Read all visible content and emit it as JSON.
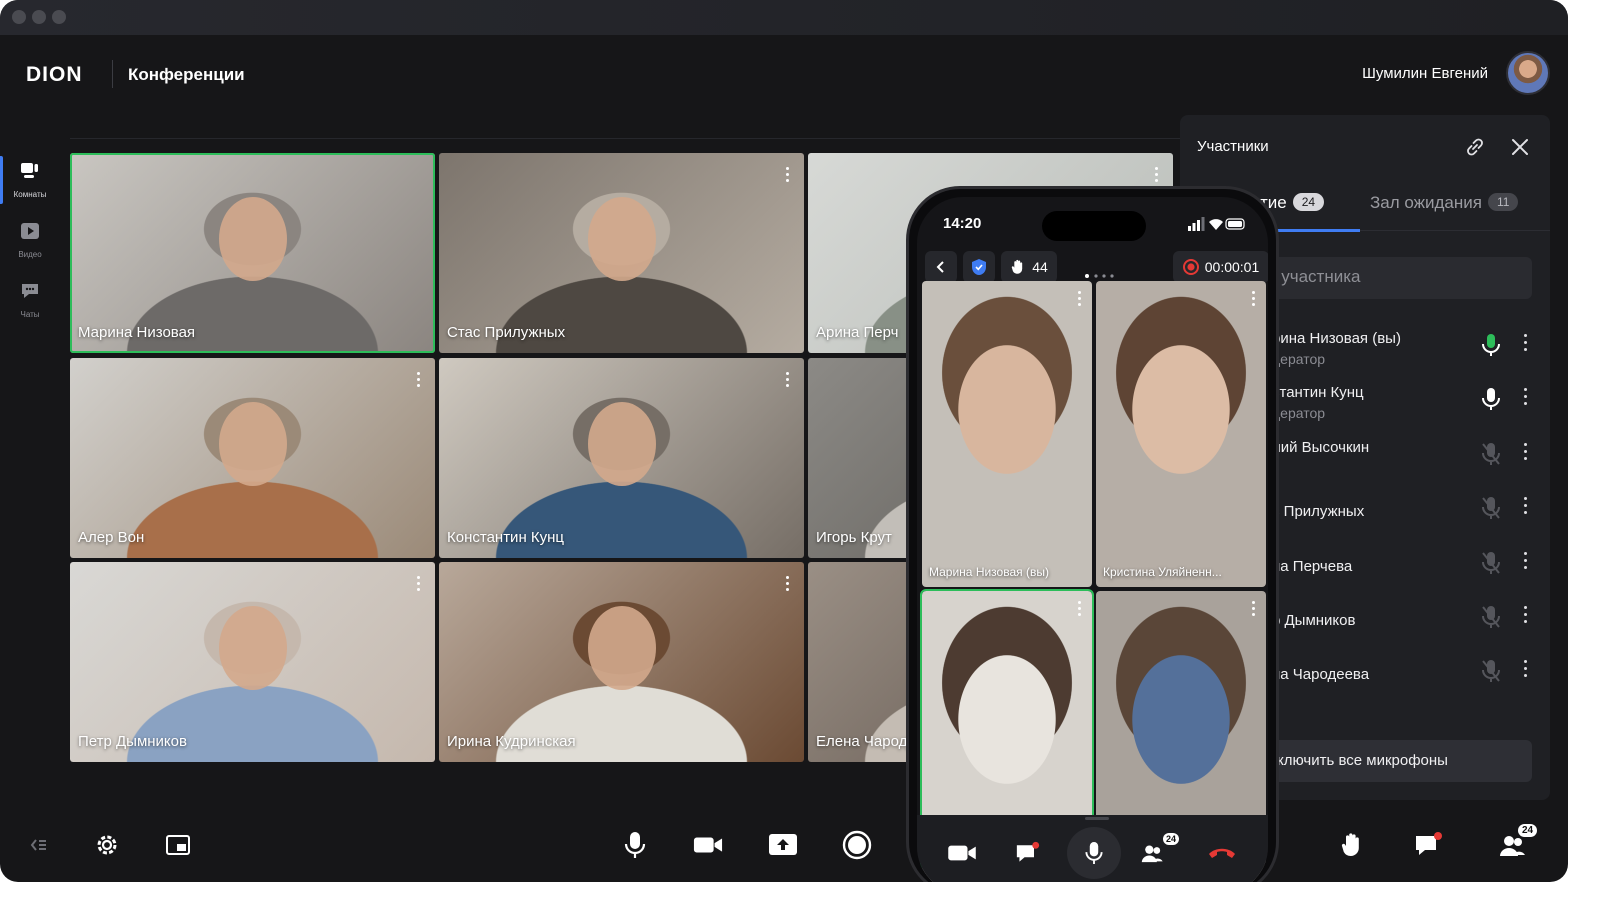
{
  "app": {
    "logo": "DION",
    "title": "Конференции",
    "user_name": "Шумилин Евгений"
  },
  "sidebar": {
    "items": [
      {
        "label": "Комнаты",
        "icon": "rooms-icon",
        "active": true
      },
      {
        "label": "Видео",
        "icon": "video-play-icon",
        "active": false
      },
      {
        "label": "Чаты",
        "icon": "chat-icon",
        "active": false
      }
    ]
  },
  "tiles": [
    {
      "name": "Марина Низовая",
      "active": true,
      "colors": [
        "#c9c6c1",
        "#8b8580",
        "#6d6a68"
      ]
    },
    {
      "name": "Стас Прилужных",
      "active": false,
      "colors": [
        "#7d756d",
        "#b5aca1",
        "#4e4842"
      ]
    },
    {
      "name": "Арина Перч",
      "active": false,
      "colors": [
        "#d7d9d6",
        "#b8bcb7",
        "#889086"
      ]
    },
    {
      "name": "Алер Вон",
      "active": false,
      "colors": [
        "#d2d0cc",
        "#9b8a78",
        "#a86f4a"
      ]
    },
    {
      "name": "Константин Кунц",
      "active": false,
      "colors": [
        "#cfc9c0",
        "#766e66",
        "#365779"
      ]
    },
    {
      "name": "Игорь Крут",
      "active": false,
      "colors": [
        "#8c8a86",
        "#5c5954",
        "#c2beb8"
      ]
    },
    {
      "name": "Петр Дымников",
      "active": false,
      "colors": [
        "#d9d8d5",
        "#c5b8ad",
        "#8aa2c2"
      ]
    },
    {
      "name": "Ирина Кудринская",
      "active": false,
      "colors": [
        "#b8a89a",
        "#6b4a33",
        "#e0ddd6"
      ]
    },
    {
      "name": "Елена Чарод",
      "active": false,
      "colors": [
        "#9a8f85",
        "#5d524a",
        "#c4bcb3"
      ]
    }
  ],
  "controls": {
    "left": [
      "collapse-icon",
      "gear-icon",
      "picture-in-picture-icon"
    ],
    "center": [
      "microphone-icon",
      "camera-icon",
      "share-screen-icon",
      "record-icon"
    ],
    "right": [
      "raise-hand-icon",
      "chat-icon",
      "participants-icon"
    ],
    "participants_count": "24"
  },
  "panel": {
    "title": "Участники",
    "tabs": [
      {
        "label": "тие",
        "count": "24",
        "active": true
      },
      {
        "label": "Зал ожидания",
        "count": "11",
        "active": false
      }
    ],
    "search_placeholder": "и участника",
    "participants": [
      {
        "name": "рина Низовая (вы)",
        "role": "дератор",
        "mic": "on"
      },
      {
        "name": "стантин Кунц",
        "role": "дератор",
        "mic": "on-white"
      },
      {
        "name": "лий Высочкин",
        "role": "ь",
        "mic": "off"
      },
      {
        "name": "с Прилужных",
        "role": "",
        "mic": "off"
      },
      {
        "name": "на Перчева",
        "role": "",
        "mic": "off"
      },
      {
        "name": "р Дымников",
        "role": "",
        "mic": "off"
      },
      {
        "name": "на Чародеева",
        "role": "",
        "mic": "off"
      }
    ],
    "mute_all_label": "ключить все микрофоны"
  },
  "phone": {
    "time": "14:20",
    "hands_count": "44",
    "timer": "00:00:01",
    "tiles": [
      {
        "name": "Марина Низовая (вы)",
        "colors": [
          "#c4bfb8",
          "#6a4f3c",
          "#d8b69e"
        ]
      },
      {
        "name": "Кристина Уляйненн...",
        "colors": [
          "#b6aea6",
          "#5e4434",
          "#dcbca5"
        ]
      },
      {
        "name": "",
        "colors": [
          "#d7d3cd",
          "#4d3b31",
          "#e8e4de"
        ]
      },
      {
        "name": "",
        "colors": [
          "#a9a29b",
          "#5a4638",
          "#54709a"
        ]
      }
    ],
    "participants_count": "24"
  },
  "colors": {
    "accent": "#3f7cf2",
    "active_green": "#2dbd5a",
    "end_call": "#e53935"
  }
}
